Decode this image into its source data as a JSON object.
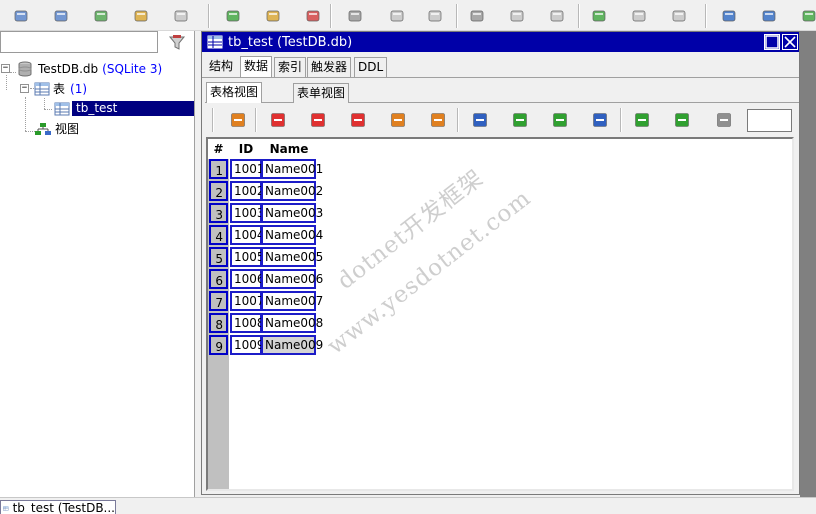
{
  "toolbar": {
    "buttons": [
      {
        "name": "connect-icon",
        "color": "#4a7ac8"
      },
      {
        "name": "disconnect-icon",
        "color": "#4a7ac8"
      },
      {
        "name": "add-database-icon",
        "color": "#40a040"
      },
      {
        "name": "edit-database-icon",
        "color": "#d8a020"
      },
      {
        "name": "delete-database-icon",
        "color": "#c0c0c0"
      },
      {
        "name": "new-table-icon",
        "color": "#30a030"
      },
      {
        "name": "edit-table-icon",
        "color": "#d8a020"
      },
      {
        "name": "delete-table-icon",
        "color": "#d03030"
      },
      {
        "name": "new-index-icon",
        "color": "#909090"
      },
      {
        "name": "edit-index-icon",
        "color": "#c0c0c0"
      },
      {
        "name": "delete-index-icon",
        "color": "#c0c0c0"
      },
      {
        "name": "new-trigger-icon",
        "color": "#909090"
      },
      {
        "name": "edit-trigger-icon",
        "color": "#c0c0c0"
      },
      {
        "name": "delete-trigger-icon",
        "color": "#c0c0c0"
      },
      {
        "name": "new-view-icon",
        "color": "#30a030"
      },
      {
        "name": "edit-view-icon",
        "color": "#c0c0c0"
      },
      {
        "name": "delete-view-icon",
        "color": "#c0c0c0"
      },
      {
        "name": "cascade-windows-icon",
        "color": "#2060c0"
      },
      {
        "name": "tile-windows-icon",
        "color": "#2060c0"
      },
      {
        "name": "refresh-icon",
        "color": "#30a030"
      }
    ]
  },
  "tree": {
    "database_name": "TestDB.db",
    "database_type": "(SQLite 3)",
    "tables_label": "表",
    "tables_count": "(1)",
    "table_item": "tb_test",
    "views_label": "视图"
  },
  "window": {
    "title": "tb_test (TestDB.db)",
    "tabs": [
      "结构",
      "数据",
      "索引",
      "触发器",
      "DDL"
    ],
    "subtabs": [
      "表格视图",
      "表单视图"
    ]
  },
  "grid_toolbar": {
    "buttons": [
      {
        "name": "reload-icon",
        "color": "#e08020"
      },
      {
        "name": "insert-row-icon",
        "color": "#e03030"
      },
      {
        "name": "add-row-icon",
        "color": "#e03030"
      },
      {
        "name": "delete-row-icon",
        "color": "#e03030"
      },
      {
        "name": "commit-icon",
        "color": "#e08020"
      },
      {
        "name": "cancel-icon",
        "color": "#e08020"
      },
      {
        "name": "first-record-icon",
        "color": "#3060c0"
      },
      {
        "name": "prev-record-icon",
        "color": "#30a030"
      },
      {
        "name": "next-record-icon",
        "color": "#30a030"
      },
      {
        "name": "last-record-icon",
        "color": "#3060c0"
      },
      {
        "name": "grid-view-icon",
        "color": "#30a030"
      },
      {
        "name": "form-view-icon",
        "color": "#30a030"
      },
      {
        "name": "export-icon",
        "color": "#909090"
      }
    ]
  },
  "grid": {
    "columns": [
      "#",
      "ID",
      "Name"
    ],
    "rows": [
      [
        "1",
        "1001",
        "Name001"
      ],
      [
        "2",
        "1002",
        "Name002"
      ],
      [
        "3",
        "1003",
        "Name003"
      ],
      [
        "4",
        "1004",
        "Name004"
      ],
      [
        "5",
        "1005",
        "Name005"
      ],
      [
        "6",
        "1006",
        "Name006"
      ],
      [
        "7",
        "1007",
        "Name007"
      ],
      [
        "8",
        "1008",
        "Name008"
      ],
      [
        "9",
        "1009",
        "Name009"
      ]
    ]
  },
  "watermark": {
    "line1": "dotnet开发框架",
    "line2": "www.yesdotnet.com"
  },
  "bottom": {
    "tab_label": "tb_test (TestDB..."
  }
}
